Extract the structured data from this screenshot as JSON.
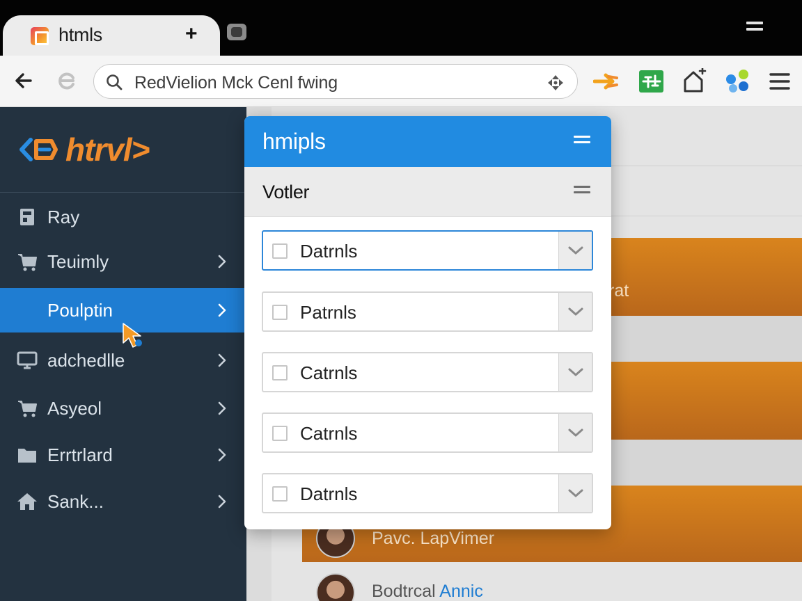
{
  "browser": {
    "tab": {
      "title": "htmls",
      "new_tab_symbol": "+"
    },
    "address_bar": {
      "value": "RedVielion Mck Cenl fwing"
    },
    "toolbar_icons": [
      "extension-orange-icon",
      "extension-green-icon",
      "extension-house-icon",
      "extension-dots-icon",
      "browser-menu-icon"
    ]
  },
  "sidebar": {
    "brand": "htrvl>",
    "items": [
      {
        "label": "Ray",
        "icon": "book-icon",
        "has_chevron": false,
        "active": false
      },
      {
        "label": "Teuimly",
        "icon": "cart-icon",
        "has_chevron": true,
        "active": false
      },
      {
        "label": "Poulptin",
        "icon": "none",
        "has_chevron": true,
        "active": true
      },
      {
        "label": "adchedlle",
        "icon": "monitor-icon",
        "has_chevron": true,
        "active": false
      },
      {
        "label": "Asyeol",
        "icon": "cart-icon",
        "has_chevron": true,
        "active": false
      },
      {
        "label": "Errtrlard",
        "icon": "folder-icon",
        "has_chevron": true,
        "active": false
      },
      {
        "label": "Sank...",
        "icon": "home-icon",
        "has_chevron": true,
        "active": false
      }
    ]
  },
  "dropdown_panel": {
    "title": "hmipls",
    "subtitle": "Votler",
    "options": [
      {
        "label": "Datrnls",
        "checked": false,
        "focused": true
      },
      {
        "label": "Patrnls",
        "checked": false,
        "focused": false
      },
      {
        "label": "Catrnls",
        "checked": false,
        "focused": false
      },
      {
        "label": "Catrnls",
        "checked": false,
        "focused": false
      },
      {
        "label": "Datrnls",
        "checked": false,
        "focused": false
      }
    ]
  },
  "background": {
    "row_fragment": "rat",
    "person_1": "Pavc. LapVimer",
    "person_2_first": "Bodtrcal",
    "person_2_last": "Annic"
  },
  "colors": {
    "accent_blue": "#218be1",
    "sidebar_bg": "#233240",
    "brand_orange": "#f08c2e",
    "row_orange": "#d9841d"
  }
}
